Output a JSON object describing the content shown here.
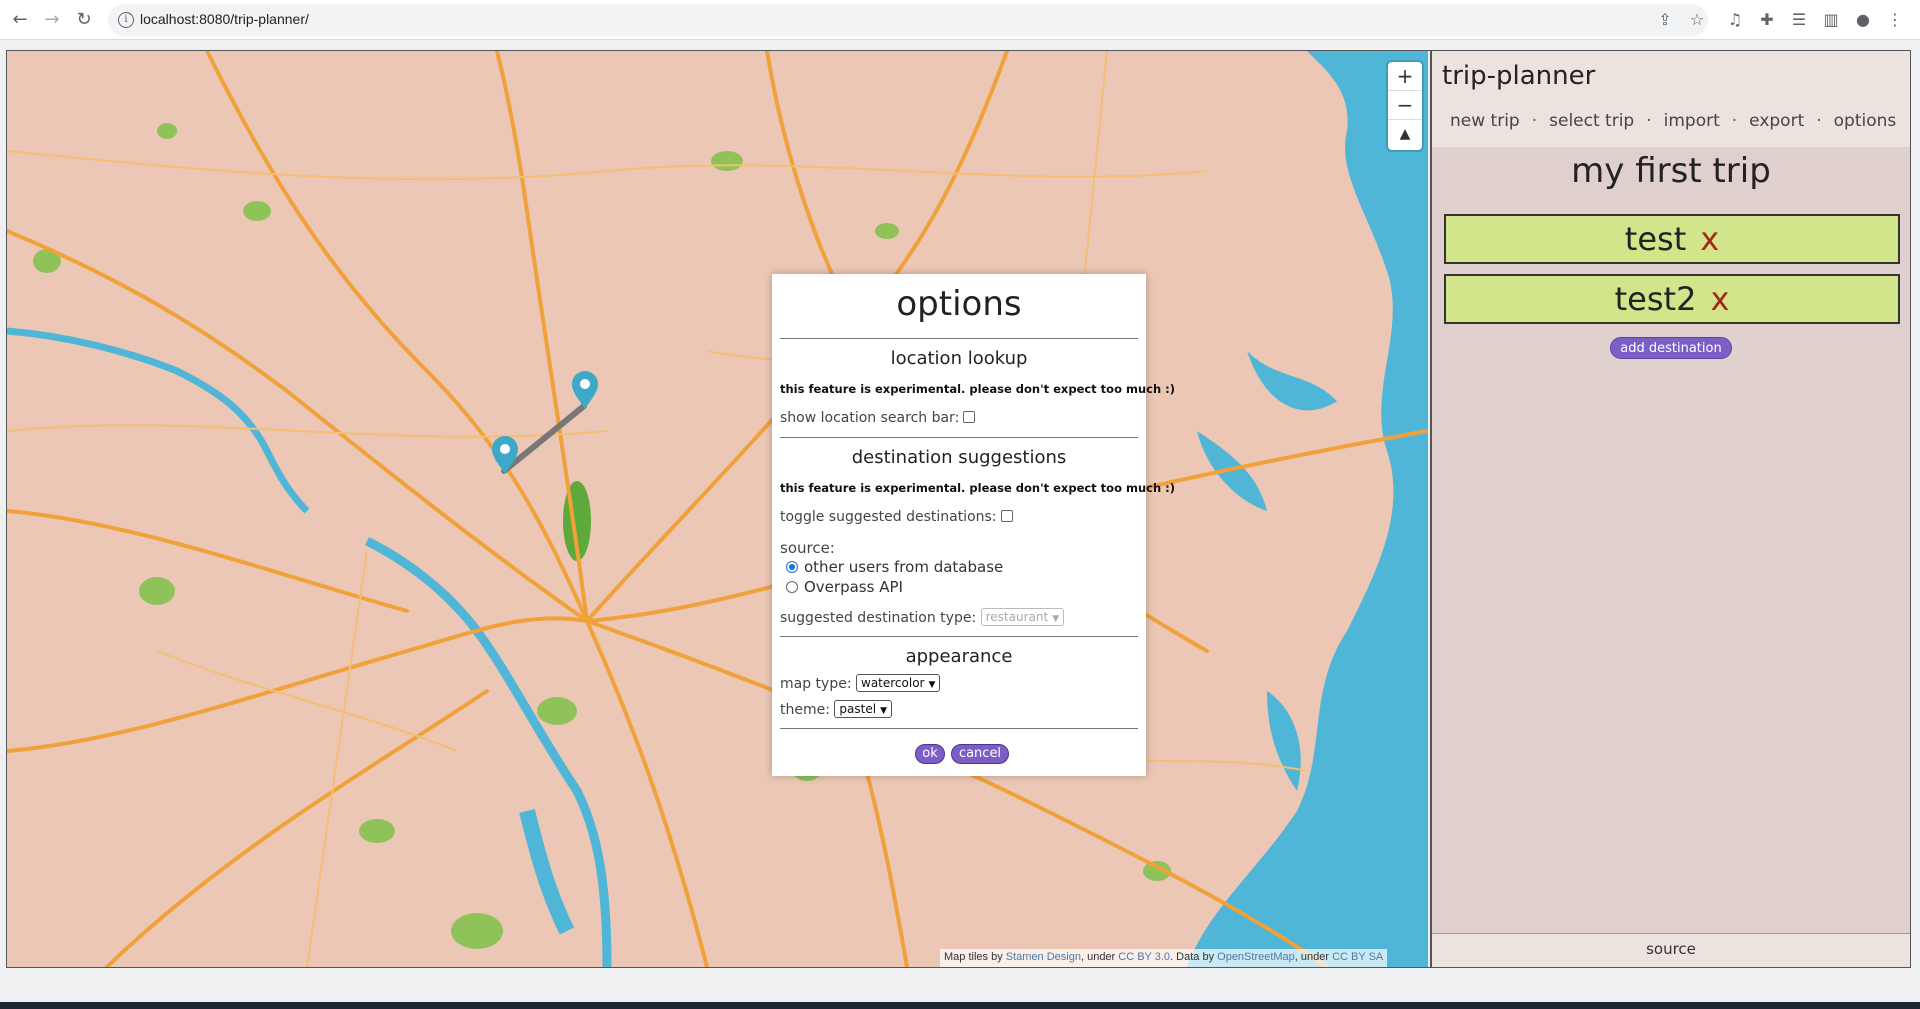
{
  "browser": {
    "url": "localhost:8080/trip-planner/"
  },
  "map": {
    "zoom_in": "+",
    "zoom_out": "−",
    "reset_north": "▲",
    "attribution": {
      "prefix": "Map tiles by ",
      "stamen": "Stamen Design",
      "under1": ", under ",
      "cc3": "CC BY 3.0",
      "data_by": ". Data by ",
      "osm": "OpenStreetMap",
      "under2": ", under ",
      "ccsa": "CC BY SA"
    },
    "colors": {
      "land": "#ecc7b5",
      "water": "#4fb6d8",
      "park": "#8fc35a",
      "road": "#f0a13a",
      "marker": "#3ea8c9"
    }
  },
  "sidebar": {
    "title": "trip-planner",
    "nav": [
      "new trip",
      "select trip",
      "import",
      "export",
      "options"
    ],
    "nav_separator": "·",
    "trip_name": "my first trip",
    "destinations": [
      {
        "name": "test",
        "remove": "x"
      },
      {
        "name": "test2",
        "remove": "x"
      }
    ],
    "add_destination": "add destination",
    "footer": "source"
  },
  "options_modal": {
    "title": "options",
    "location_lookup": {
      "heading": "location lookup",
      "note": "this feature is experimental. please don't expect too much :)",
      "show_search_bar_label": "show location search bar:"
    },
    "destination_suggestions": {
      "heading": "destination suggestions",
      "note": "this feature is experimental. please don't expect too much :)",
      "toggle_label": "toggle suggested destinations:",
      "source_label": "source:",
      "sources": [
        "other users from database",
        "Overpass API"
      ],
      "selected_source": "other users from database",
      "type_label": "suggested destination type:",
      "type_value": "restaurant"
    },
    "appearance": {
      "heading": "appearance",
      "map_type_label": "map type:",
      "map_type_value": "watercolor",
      "theme_label": "theme:",
      "theme_value": "pastel"
    },
    "ok": "ok",
    "cancel": "cancel"
  }
}
